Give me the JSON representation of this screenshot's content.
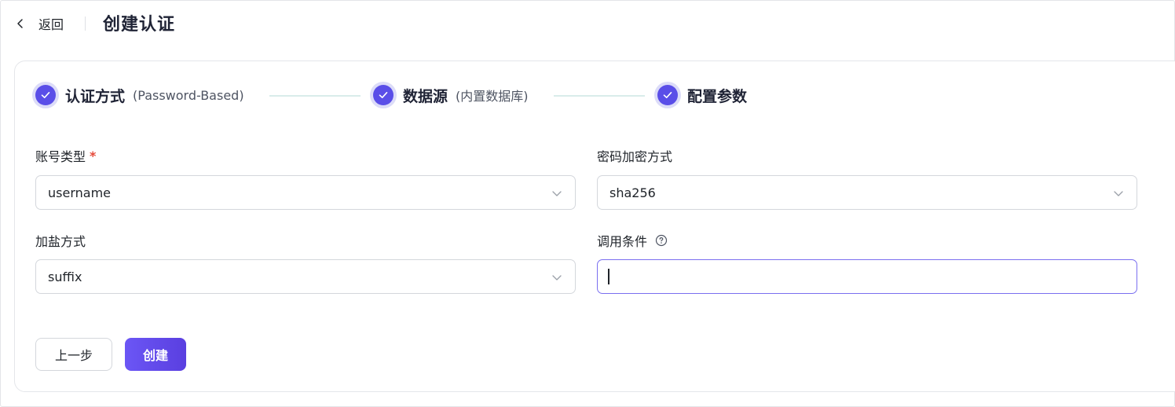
{
  "header": {
    "back_label": "返回",
    "title": "创建认证"
  },
  "steps": [
    {
      "title": "认证方式",
      "sub": "(Password-Based)",
      "status": "done"
    },
    {
      "title": "数据源",
      "sub": "(内置数据库)",
      "status": "done"
    },
    {
      "title": "配置参数",
      "sub": "",
      "status": "done"
    }
  ],
  "form": {
    "account_type": {
      "label": "账号类型",
      "required_mark": "*",
      "value": "username"
    },
    "password_hash": {
      "label": "密码加密方式",
      "value": "sha256"
    },
    "salt_position": {
      "label": "加盐方式",
      "value": "suffix"
    },
    "precondition": {
      "label": "调用条件",
      "value": "",
      "placeholder": ""
    }
  },
  "buttons": {
    "prev_label": "上一步",
    "create_label": "创建"
  },
  "colors": {
    "accent": "#5a4ee8",
    "step_halo": "#dcdcf8",
    "required": "#e5493a",
    "focus_border": "#7a6ff0"
  },
  "icons": {
    "back": "chevron-left-icon",
    "step_done": "check-icon",
    "select_arrow": "chevron-down-icon",
    "help": "question-circle-icon"
  }
}
